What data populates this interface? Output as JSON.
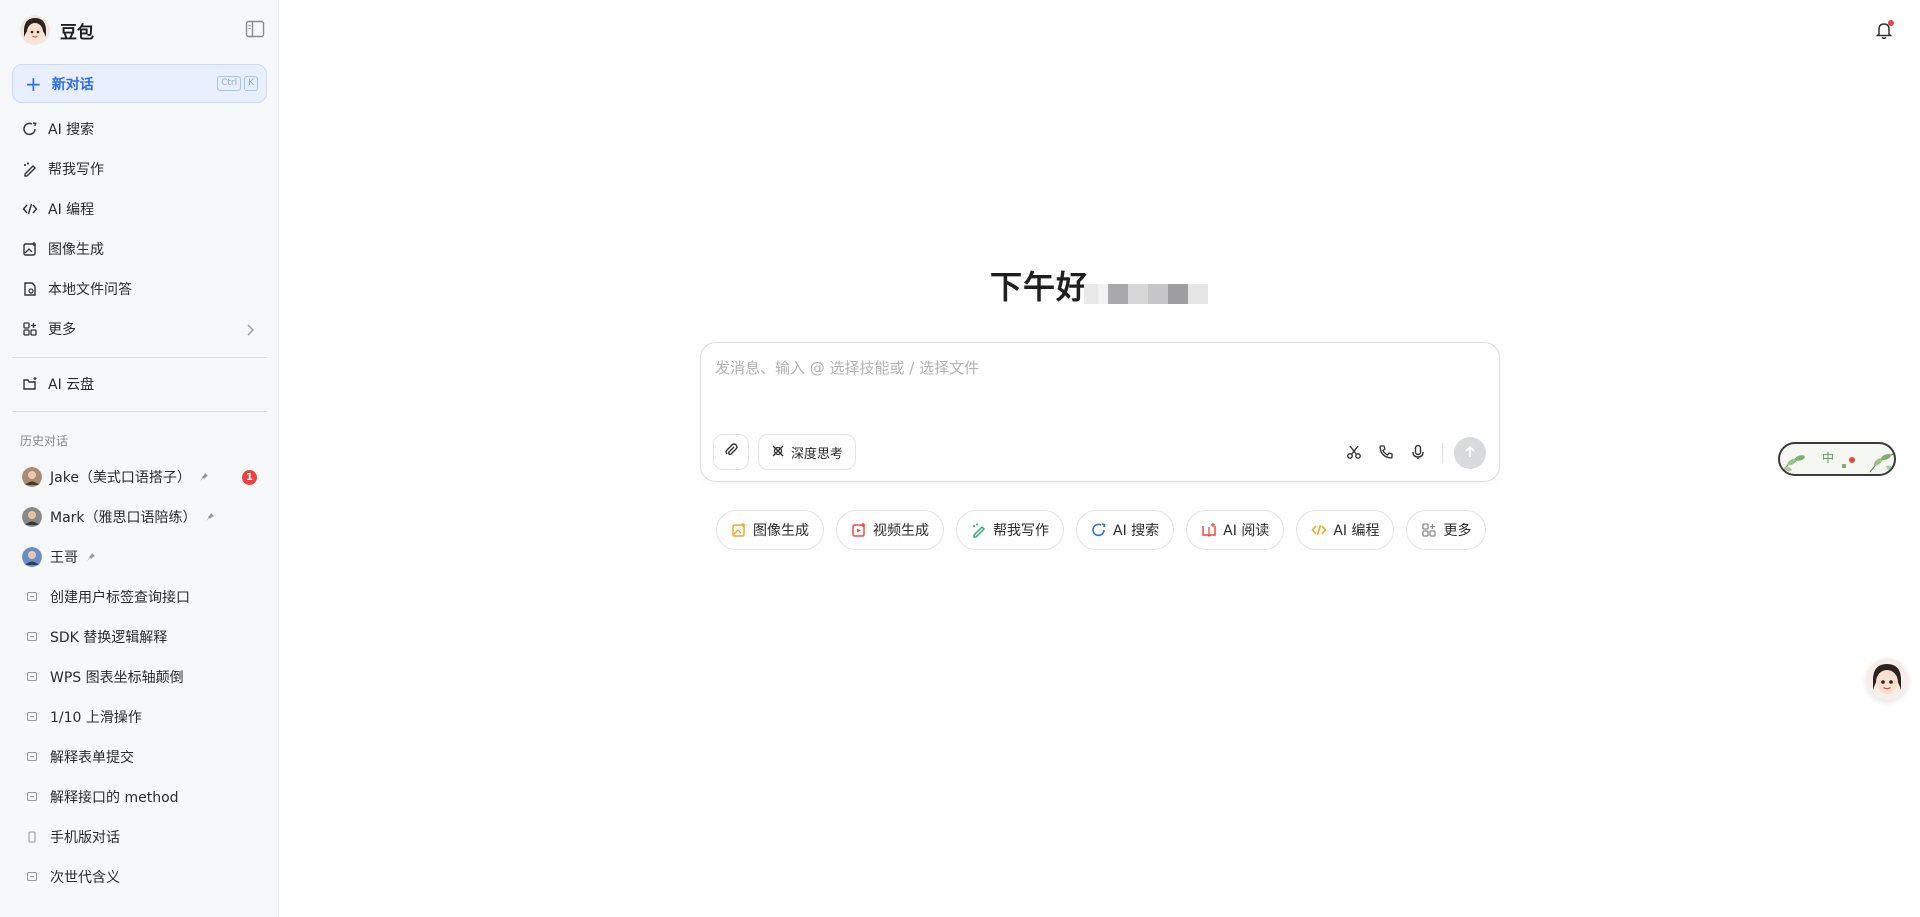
{
  "sidebar": {
    "app_title": "豆包",
    "new_chat": {
      "label": "新对话",
      "shortcut": [
        "Ctrl",
        "K"
      ]
    },
    "nav_items": [
      {
        "label": "AI 搜索",
        "icon": "search-icon"
      },
      {
        "label": "帮我写作",
        "icon": "pen-icon"
      },
      {
        "label": "AI 编程",
        "icon": "code-icon"
      },
      {
        "label": "图像生成",
        "icon": "image-icon"
      },
      {
        "label": "本地文件问答",
        "icon": "file-icon"
      },
      {
        "label": "更多",
        "icon": "grid-icon"
      }
    ],
    "cloud": {
      "label": "AI 云盘",
      "icon": "cloud-drive-icon"
    },
    "history_label": "历史对话",
    "history": [
      {
        "label": "Jake（美式口语搭子）",
        "pinned": true,
        "badge": "1",
        "type": "agent"
      },
      {
        "label": "Mark（雅思口语陪练）",
        "pinned": true,
        "type": "agent"
      },
      {
        "label": "王哥",
        "pinned": true,
        "type": "agent"
      },
      {
        "label": "创建用户标签查询接口",
        "type": "chat"
      },
      {
        "label": "SDK 替换逻辑解释",
        "type": "chat"
      },
      {
        "label": "WPS 图表坐标轴颠倒",
        "type": "chat"
      },
      {
        "label": "1/10 上滑操作",
        "type": "chat"
      },
      {
        "label": "解释表单提交",
        "type": "chat"
      },
      {
        "label": "解释接口的 method",
        "type": "chat"
      },
      {
        "label": "手机版对话",
        "type": "phone"
      },
      {
        "label": "次世代含义",
        "type": "chat"
      }
    ]
  },
  "main": {
    "greeting": "下午好，",
    "composer": {
      "placeholder": "发消息、输入 @ 选择技能或 / 选择文件",
      "deep_think_label": "深度思考"
    },
    "quick_actions": [
      {
        "label": "图像生成",
        "icon": "image-icon",
        "color": "#f5a623"
      },
      {
        "label": "视频生成",
        "icon": "video-icon",
        "color": "#f04848"
      },
      {
        "label": "帮我写作",
        "icon": "pen-icon",
        "color": "#2fb36a"
      },
      {
        "label": "AI 搜索",
        "icon": "search-icon",
        "color": "#2d6bf5"
      },
      {
        "label": "AI 阅读",
        "icon": "book-icon",
        "color": "#f04848"
      },
      {
        "label": "AI 编程",
        "icon": "code-icon",
        "color": "#f5a623"
      },
      {
        "label": "更多",
        "icon": "grid-icon",
        "color": "#8a8a8a"
      }
    ],
    "widget_text": "中"
  },
  "colors": {
    "accent": "#2d6bf5",
    "badge": "#f04040"
  }
}
